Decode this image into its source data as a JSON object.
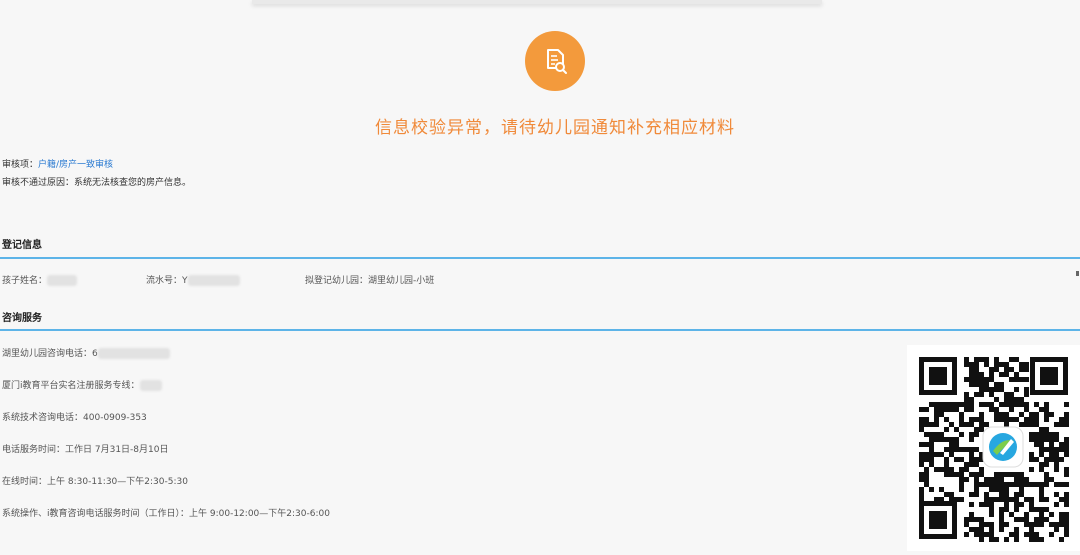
{
  "status": {
    "icon": "document-search-icon",
    "icon_color": "#f39a3c",
    "message": "信息校验异常，请待幼儿园通知补充相应材料",
    "message_color": "#f08a3a"
  },
  "audit": {
    "item_label": "审核项：",
    "item_value": "户籍/房产一致审核",
    "item_value_color": "#2a7ad1",
    "reason_label": "审核不通过原因：",
    "reason_value": "系统无法核查您的房产信息。"
  },
  "registration": {
    "title": "登记信息",
    "child_name_label": "孩子姓名：",
    "child_name_value": "",
    "serial_label": "流水号：",
    "serial_value": "Y",
    "kindergarten_label": "拟登记幼儿园：",
    "kindergarten_value": "湖里幼儿园-小班"
  },
  "consulting": {
    "title": "咨询服务",
    "rows": [
      {
        "label": "湖里幼儿园咨询电话：",
        "value": "6"
      },
      {
        "label": "厦门i教育平台实名注册服务专线：",
        "value": ""
      },
      {
        "label": "系统技术咨询电话：",
        "value": "400-0909-353"
      },
      {
        "label": "电话服务时间：",
        "value": "工作日 7月31日-8月10日"
      },
      {
        "label": "在线时间：",
        "value": "上午 8:30-11:30—下午2:30-5:30"
      },
      {
        "label": "系统操作、i教育咨询电话服务时间（工作日）：",
        "value": "上午 9:00-12:00—下午2:30-6:00"
      }
    ]
  },
  "qr": {
    "icon": "qr-code-icon",
    "center_logo": "app-logo-icon"
  },
  "colors": {
    "accent_blue": "#5db4e8",
    "background": "#f7f7f7"
  }
}
